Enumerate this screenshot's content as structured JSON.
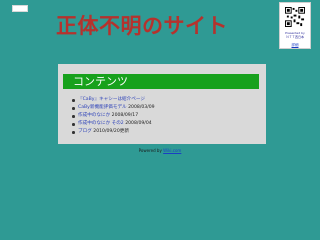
{
  "site": {
    "title": "正体不明のサイト"
  },
  "qr": {
    "caption": "Presented by\nＮＴＴ西日本\n",
    "link_label": "詳細"
  },
  "content": {
    "header": "コンテンツ",
    "items": [
      {
        "link": "『CaBy』キャシーは紹介ページ",
        "date": ""
      },
      {
        "link": "CaBy新機能評価モデル",
        "date": "2008/03/09"
      },
      {
        "link": "作成中のなにか",
        "date": "2008/09/17"
      },
      {
        "link": "作成中のなにか その2",
        "date": "2008/09/04"
      },
      {
        "link": "ブログ",
        "date": "2010/09/20更新"
      }
    ]
  },
  "footer": {
    "prefix": "Powered by",
    "link": "Wiki.com"
  }
}
